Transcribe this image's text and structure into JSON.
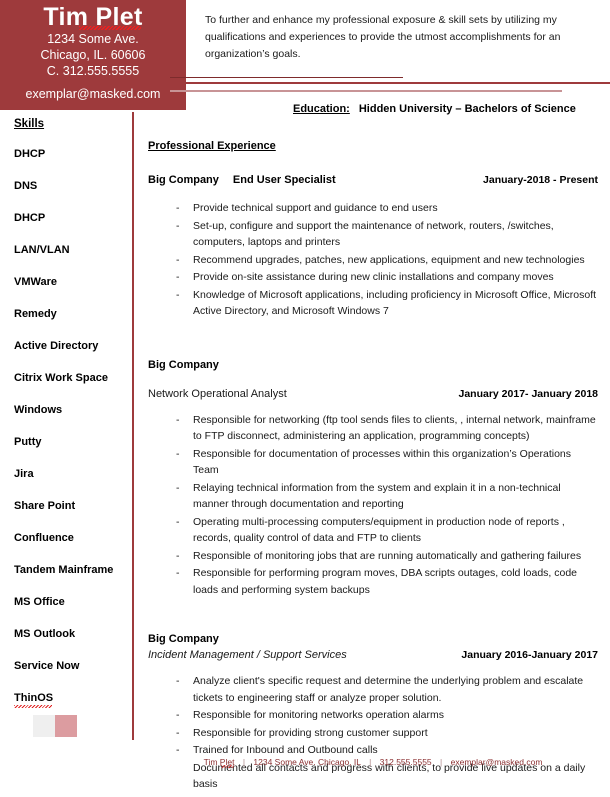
{
  "header": {
    "name": "Tim Plet",
    "address_line1": "1234 Some Ave.",
    "address_line2": "Chicago, IL. 60606",
    "phone_line": "C. 312.555.5555",
    "email": "exemplar@masked.com",
    "block_color": "#9e3a3c"
  },
  "summary": {
    "text": "To further and enhance my professional exposure & skill sets by utilizing my qualifications and experiences to provide the utmost accomplishments for an organization’s goals."
  },
  "education": {
    "label": "Education:",
    "value": "Hidden University – Bachelors of Science"
  },
  "sidebar": {
    "title": "Skills",
    "items": [
      {
        "label": "DHCP"
      },
      {
        "label": "DNS"
      },
      {
        "label": "DHCP"
      },
      {
        "label": "LAN/VLAN"
      },
      {
        "label": "VMWare"
      },
      {
        "label": "Remedy"
      },
      {
        "label": "Active Directory"
      },
      {
        "label": "Citrix Work Space"
      },
      {
        "label": "Windows"
      },
      {
        "label": "Putty"
      },
      {
        "label": "Jira"
      },
      {
        "label": "Share Point"
      },
      {
        "label": "Confluence"
      },
      {
        "label": "Tandem Mainframe"
      },
      {
        "label": "MS Office"
      },
      {
        "label": "MS Outlook"
      },
      {
        "label": "Service Now"
      },
      {
        "label": "ThinOS"
      }
    ],
    "swatch_gray": "#efefef",
    "swatch_pink": "#dc9ca0"
  },
  "main": {
    "section_title": "Professional Experience",
    "jobs": [
      {
        "company": "Big Company",
        "title": "End User Specialist",
        "date": "January-2018 - Present",
        "bullets": [
          "Provide technical support and guidance to end users",
          "Set-up, configure and support the maintenance of network, routers, /switches, computers, laptops and printers",
          "Recommend upgrades, patches, new applications, equipment and new technologies",
          "Provide on-site assistance during new clinic installations and company moves",
          "Knowledge of Microsoft applications, including proficiency in Microsoft Office, Microsoft Active Directory, and Microsoft Windows 7"
        ]
      },
      {
        "company": "Big Company",
        "title": "Network Operational Analyst",
        "date": "January 2017- January 2018",
        "bullets": [
          "Responsible for networking (ftp tool sends files to clients, , internal network,  mainframe to FTP disconnect, administering an application, programming concepts)",
          "Responsible for documentation of processes within this organization’s Operations Team",
          "Relaying technical information from the system and explain it in a non-technical manner through documentation and reporting",
          "Operating multi-processing computers/equipment in production node of reports , records, quality control of data and FTP to clients",
          "Responsible of  monitoring jobs that are running automatically and gathering failures",
          "Responsible for performing program moves, DBA scripts outages, cold loads, code loads and performing system backups"
        ]
      },
      {
        "company": "Big Company",
        "title": "Incident Management / Support Services",
        "date": "January 2016-January 2017",
        "bullets": [
          "Analyze client's specific request and determine the underlying problem and escalate tickets to engineering staff or analyze proper solution.",
          "Responsible for monitoring networks operation alarms",
          "Responsible for  providing strong customer support",
          "Trained for Inbound and Outbound calls"
        ],
        "trailing_line": "Documented all contacts and progress with clients, to provide live updates on a daily basis"
      }
    ]
  },
  "footer": {
    "name": "Tim Plet",
    "address": "1234 Some Ave. Chicago, IL",
    "phone": "312.555.5555",
    "email": "exemplar@masked.com",
    "separator": "|",
    "color": "#8a2f31"
  }
}
